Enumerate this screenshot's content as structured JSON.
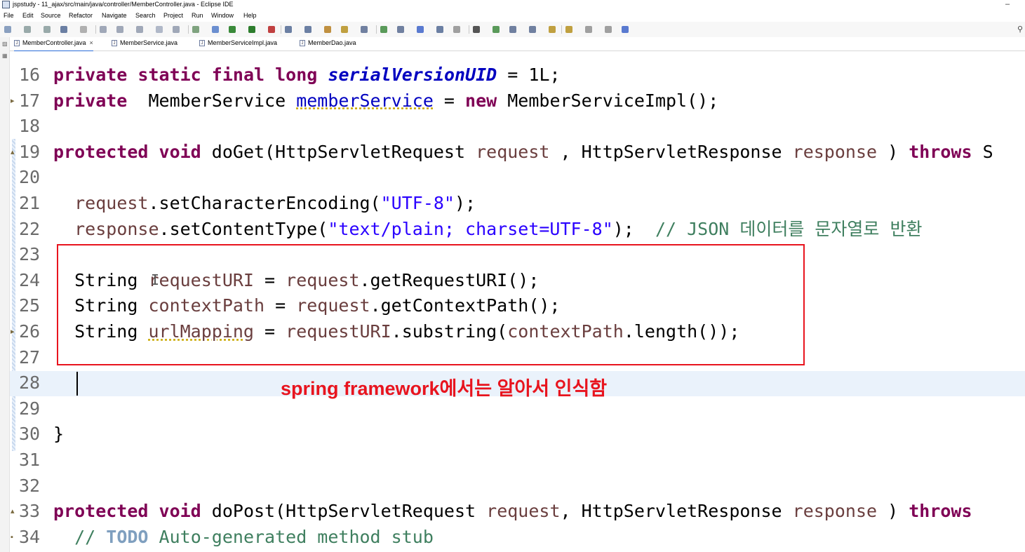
{
  "window": {
    "title": "jspstudy - 11_ajax/src/main/java/controller/MemberController.java - Eclipse IDE",
    "minimize_label": "–"
  },
  "menubar": [
    "File",
    "Edit",
    "Source",
    "Refactor",
    "Navigate",
    "Search",
    "Project",
    "Run",
    "Window",
    "Help"
  ],
  "tabs": [
    {
      "label": "MemberController.java",
      "active": true
    },
    {
      "label": "MemberService.java",
      "active": false
    },
    {
      "label": "MemberServiceImpl.java",
      "active": false
    },
    {
      "label": "MemberDao.java",
      "active": false
    }
  ],
  "editor": {
    "lines": [
      {
        "n": "16",
        "segs": [
          [
            "kw",
            "private"
          ],
          [
            "",
            " "
          ],
          [
            "kw",
            "static"
          ],
          [
            "",
            " "
          ],
          [
            "kw",
            "final"
          ],
          [
            "",
            " "
          ],
          [
            "kw",
            "long"
          ],
          [
            "",
            " "
          ],
          [
            "sfld",
            "serialVersionUID"
          ],
          [
            "",
            " = 1L;"
          ]
        ]
      },
      {
        "n": "17",
        "segs": [
          [
            "kw",
            "private"
          ],
          [
            "",
            "",
            " "
          ],
          [
            "",
            " MemberService "
          ],
          [
            "fld ul",
            "memberService"
          ],
          [
            "",
            " = "
          ],
          [
            "kw",
            "new"
          ],
          [
            "",
            " MemberServiceImpl();"
          ]
        ]
      },
      {
        "n": "18",
        "segs": []
      },
      {
        "n": "19",
        "segs": [
          [
            "kw",
            "protected"
          ],
          [
            "",
            " "
          ],
          [
            "kw",
            "void"
          ],
          [
            "",
            " doGet(HttpServletRequest "
          ],
          [
            "var",
            "request"
          ],
          [
            "",
            " , HttpServletResponse "
          ],
          [
            "var",
            "response"
          ],
          [
            "",
            " ) "
          ],
          [
            "kw",
            "throws"
          ],
          [
            "",
            " S"
          ]
        ]
      },
      {
        "n": "20",
        "segs": []
      },
      {
        "n": "21",
        "segs": [
          [
            "",
            "  "
          ],
          [
            "var",
            "request"
          ],
          [
            "",
            ".setCharacterEncoding("
          ],
          [
            "str",
            "\"UTF-8\""
          ],
          [
            "",
            ");"
          ]
        ]
      },
      {
        "n": "22",
        "segs": [
          [
            "",
            "  "
          ],
          [
            "var",
            "response"
          ],
          [
            "",
            ".setContentType("
          ],
          [
            "str",
            "\"text/plain; charset=UTF-8\""
          ],
          [
            "",
            "); "
          ],
          [
            "cmt",
            " // JSON 데이터를 문자열로 반환"
          ]
        ]
      },
      {
        "n": "23",
        "segs": []
      },
      {
        "n": "24",
        "segs": [
          [
            "",
            "  String "
          ],
          [
            "var",
            "requestURI"
          ],
          [
            "",
            " = "
          ],
          [
            "var",
            "request"
          ],
          [
            "",
            ".getRequestURI();"
          ]
        ]
      },
      {
        "n": "25",
        "segs": [
          [
            "",
            "  String "
          ],
          [
            "var",
            "contextPath"
          ],
          [
            "",
            " = "
          ],
          [
            "var",
            "request"
          ],
          [
            "",
            ".getContextPath();"
          ]
        ]
      },
      {
        "n": "26",
        "segs": [
          [
            "",
            "  String "
          ],
          [
            "var ul",
            "urlMapping"
          ],
          [
            "",
            " = "
          ],
          [
            "var",
            "requestURI"
          ],
          [
            "",
            ".substring("
          ],
          [
            "var",
            "contextPath"
          ],
          [
            "",
            ".length());"
          ]
        ]
      },
      {
        "n": "27",
        "segs": []
      },
      {
        "n": "28",
        "segs": []
      },
      {
        "n": "29",
        "segs": []
      },
      {
        "n": "30",
        "segs": [
          [
            "",
            "}"
          ]
        ]
      },
      {
        "n": "31",
        "segs": []
      },
      {
        "n": "32",
        "segs": []
      },
      {
        "n": "33",
        "segs": [
          [
            "kw",
            "protected"
          ],
          [
            "",
            " "
          ],
          [
            "kw",
            "void"
          ],
          [
            "",
            " doPost(HttpServletRequest "
          ],
          [
            "var",
            "request"
          ],
          [
            "",
            ", HttpServletResponse "
          ],
          [
            "var",
            "response"
          ],
          [
            "",
            " ) "
          ],
          [
            "kw",
            "throws"
          ]
        ]
      },
      {
        "n": "34",
        "segs": [
          [
            "cmt",
            "  // "
          ],
          [
            "todo",
            "TODO"
          ],
          [
            "cmt",
            " Auto-generated method stub"
          ]
        ]
      }
    ]
  },
  "annotation": {
    "text": "spring framework에서는 알아서 인식함",
    "color": "#e8141e"
  },
  "colors": {
    "keyword": "#7f0055",
    "field": "#0000c0",
    "string": "#2a00ff",
    "comment": "#3f7f5f",
    "highlight_box": "#e8141e"
  }
}
